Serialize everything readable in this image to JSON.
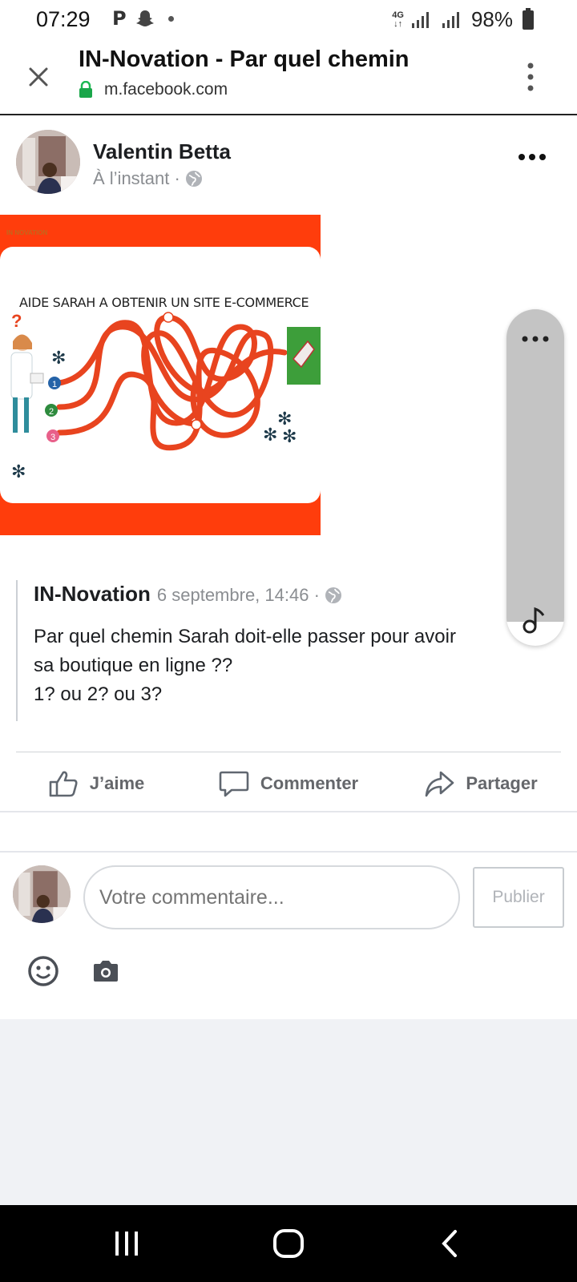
{
  "status_bar": {
    "time": "07:29",
    "network": "4G",
    "battery": "98%",
    "icons": [
      "parking-icon",
      "snapchat-icon",
      "dot-icon",
      "signal-icon",
      "battery-icon"
    ]
  },
  "browser": {
    "title": "IN-Novation - Par quel chemin",
    "url": "m.facebook.com"
  },
  "post": {
    "author": "Valentin Betta",
    "time": "À l’instant ·",
    "image": {
      "brand": "IN NOVATION",
      "headline": "AIDE SARAH  A  OBTENIR UN SITE E-COMMERCE",
      "path_numbers": [
        "1",
        "2",
        "3"
      ]
    },
    "shared": {
      "source": "IN-Novation",
      "date": "6 septembre, 14:46 ·",
      "text": "Par quel chemin Sarah doit-elle passer pour avoir\nsa boutique en ligne ??\n1? ou 2? ou 3?"
    },
    "actions": {
      "like": "J’aime",
      "comment": "Commenter",
      "share": "Partager"
    }
  },
  "composer": {
    "placeholder": "Votre commentaire...",
    "publish": "Publier"
  },
  "colors": {
    "image_background": "#ff3d0c",
    "path_red": "#e8441f",
    "grey_text": "#65676b"
  }
}
